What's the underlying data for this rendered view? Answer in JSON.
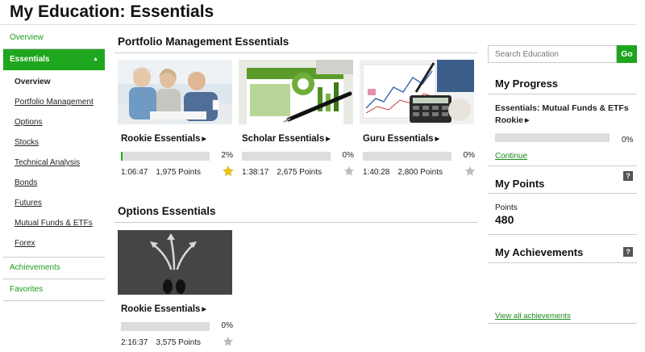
{
  "page": {
    "title": "My Education: Essentials"
  },
  "sidebar": {
    "overview": "Overview",
    "essentials": "Essentials",
    "sub_items": [
      "Overview",
      "Portfolio Management",
      "Options",
      "Stocks",
      "Technical Analysis",
      "Bonds",
      "Futures",
      "Mutual Funds & ETFs",
      "Forex"
    ],
    "achievements": "Achievements",
    "favorites": "Favorites"
  },
  "portfolio": {
    "title": "Portfolio Management Essentials",
    "courses": [
      {
        "name": "Rookie Essentials",
        "progress": 2,
        "pct_label": "2%",
        "time": "1:06:47",
        "points": "1,975 Points",
        "star": "gold"
      },
      {
        "name": "Scholar Essentials",
        "progress": 0,
        "pct_label": "0%",
        "time": "1:38:17",
        "points": "2,675 Points",
        "star": "gray"
      },
      {
        "name": "Guru Essentials",
        "progress": 0,
        "pct_label": "0%",
        "time": "1:40:28",
        "points": "2,800 Points",
        "star": "gray"
      }
    ]
  },
  "options": {
    "title": "Options Essentials",
    "courses": [
      {
        "name": "Rookie Essentials",
        "progress": 0,
        "pct_label": "0%",
        "time": "2:16:37",
        "points": "3,575 Points",
        "star": "gray"
      }
    ]
  },
  "search": {
    "placeholder": "Search Education",
    "button": "Go"
  },
  "my_progress": {
    "title": "My Progress",
    "course_title": "Essentials: Mutual Funds & ETFs",
    "course_level": "Rookie",
    "progress": 0,
    "pct_label": "0%",
    "continue": "Continue"
  },
  "my_points": {
    "title": "My Points",
    "label": "Points",
    "value": "480",
    "help": "?"
  },
  "my_achievements": {
    "title": "My Achievements",
    "help": "?",
    "view_all": "View all achievements"
  },
  "colors": {
    "accent": "#1ea61e",
    "link": "#1a9d1a",
    "star_gold": "#f2c200",
    "star_gray": "#bbbbbb"
  }
}
